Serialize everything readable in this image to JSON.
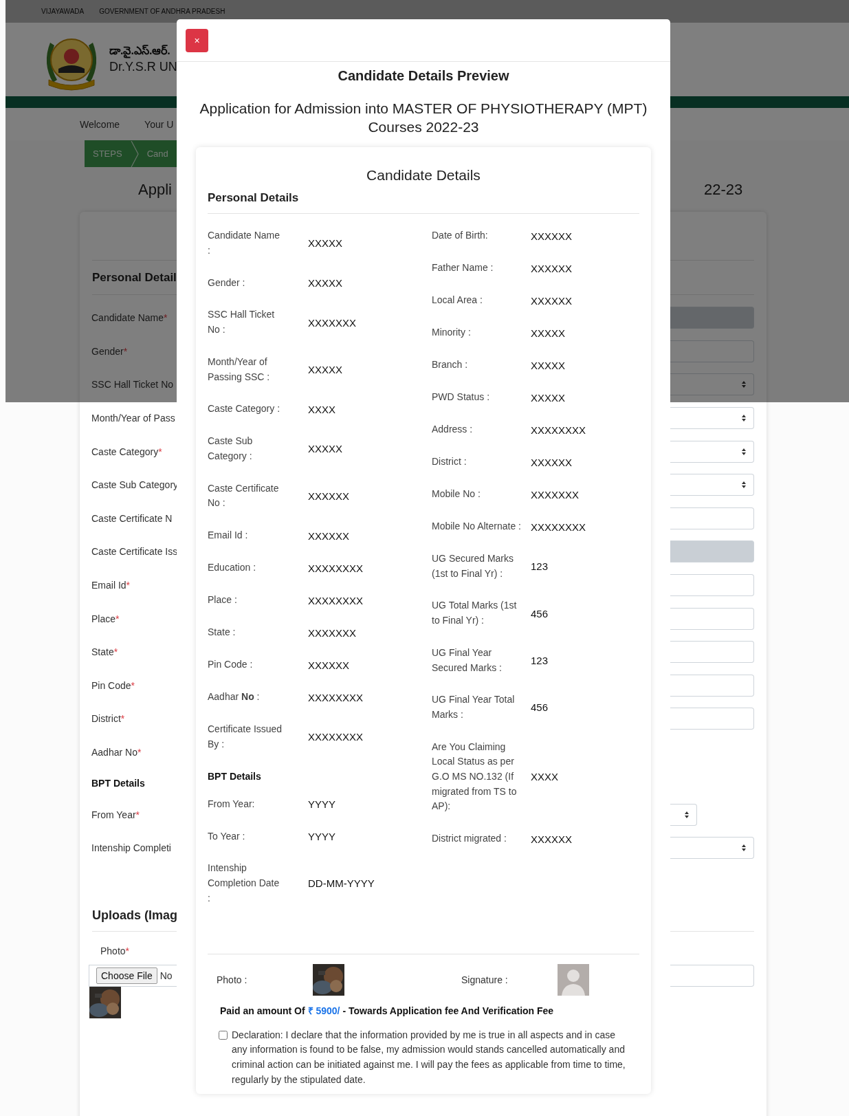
{
  "top_bar": [
    "VIJAYAWADA",
    "GOVERNMENT OF ANDHRA PRADESH"
  ],
  "header": {
    "title_telugu": "డా.వై.ఎస్.ఆర్.",
    "title": "Dr.Y.S.R UN"
  },
  "nav": [
    "Welcome",
    "Your U"
  ],
  "steps": [
    "STEPS",
    "Cand"
  ],
  "page_heading": {
    "left": "Appli",
    "right": "22-23"
  },
  "form": {
    "section": "Personal Detail",
    "rows": [
      {
        "kind": "field",
        "label": "Candidate Name",
        "mark": "*",
        "control": {
          "kind": "input",
          "disabled": true
        }
      },
      {
        "kind": "field",
        "label": "Gender",
        "mark": "*",
        "control": {
          "kind": "input",
          "disabled": false
        }
      },
      {
        "kind": "field",
        "label": "SSC Hall Ticket No",
        "control": {
          "kind": "select"
        }
      },
      {
        "kind": "field",
        "label": "Month/Year of Pass",
        "control": {
          "kind": "select"
        }
      },
      {
        "kind": "field",
        "label": "Caste Category",
        "mark": "*",
        "control": {
          "kind": "select"
        }
      },
      {
        "kind": "field",
        "label": "Caste Sub Category",
        "control": {
          "kind": "select"
        }
      },
      {
        "kind": "field",
        "label": "Caste Certificate N",
        "control": {
          "kind": "input",
          "disabled": false
        }
      },
      {
        "kind": "field",
        "label": "Caste Certificate Iss",
        "control": {
          "kind": "input",
          "disabled": true
        }
      },
      {
        "kind": "field",
        "label": "Email Id",
        "mark": "*",
        "control": {
          "kind": "input",
          "disabled": false
        }
      },
      {
        "kind": "field",
        "label": "Place",
        "mark": "*",
        "control": {
          "kind": "input",
          "disabled": false
        }
      },
      {
        "kind": "field",
        "label": "State",
        "mark": "*",
        "control": {
          "kind": "input",
          "disabled": false
        }
      },
      {
        "kind": "field",
        "label": "Pin Code",
        "mark": "*",
        "control": {
          "kind": "input",
          "disabled": false
        }
      },
      {
        "kind": "field",
        "label": "District",
        "mark": "*",
        "control": {
          "kind": "input",
          "disabled": false
        }
      },
      {
        "kind": "field",
        "label": "Aadhar No",
        "mark": "*"
      },
      {
        "kind": "heading",
        "label": "BPT Details"
      },
      {
        "kind": "field",
        "label": "From Year",
        "mark": "*",
        "control": {
          "kind": "short_select"
        }
      },
      {
        "kind": "field",
        "label": "Intenship Completi",
        "control": {
          "kind": "select"
        }
      }
    ],
    "uploads": {
      "title": "Uploads (Imag",
      "photo_label": "Photo",
      "photo_mark": "*",
      "choose_button": "Choose File",
      "file_status": "No"
    }
  },
  "modal": {
    "close": "×",
    "title": "Candidate Details Preview",
    "heading": "Application for Admission into MASTER OF PHYSIOTHERAPY (MPT) Courses 2022-23",
    "card_title": "Candidate Details",
    "section": "Personal Details",
    "left": [
      {
        "kind": "field",
        "label": "Candidate Name :",
        "value": "XXXXX"
      },
      {
        "kind": "field",
        "label": "Gender :",
        "value": "XXXXX"
      },
      {
        "kind": "field",
        "label": "SSC Hall Ticket No :",
        "value": "XXXXXXX"
      },
      {
        "kind": "field",
        "label": "Month/Year of Passing SSC :",
        "value": "XXXXX"
      },
      {
        "kind": "field",
        "label": "Caste Category :",
        "value": "XXXX"
      },
      {
        "kind": "field",
        "label": "Caste Sub Category :",
        "value": "XXXXX"
      },
      {
        "kind": "field",
        "label": "Caste Certificate No :",
        "value": "XXXXXX"
      },
      {
        "kind": "field",
        "label": "Email Id :",
        "value": "XXXXXX"
      },
      {
        "kind": "field",
        "label": "Education :",
        "value": "XXXXXXXX"
      },
      {
        "kind": "field",
        "label": "Place :",
        "value": "XXXXXXXX"
      },
      {
        "kind": "field",
        "label": "State :",
        "value": "XXXXXXX"
      },
      {
        "kind": "field",
        "label": "Pin Code :",
        "value": "XXXXXX"
      },
      {
        "kind": "field",
        "label": "Aadhar **No** :",
        "value": "XXXXXXXX"
      },
      {
        "kind": "field",
        "label": "Certificate Issued By :",
        "value": "XXXXXXXX"
      },
      {
        "kind": "heading",
        "label": "BPT Details"
      },
      {
        "kind": "field",
        "label": "From Year:",
        "value": "YYYY"
      },
      {
        "kind": "field",
        "label": "To Year :",
        "value": "YYYY"
      },
      {
        "kind": "field",
        "label": "Intenship Completion Date :",
        "value": "DD-MM-YYYY"
      }
    ],
    "right": [
      {
        "kind": "field",
        "label": "Date of Birth:",
        "value": "XXXXXX"
      },
      {
        "kind": "field",
        "label": "Father Name :",
        "value": "XXXXXX"
      },
      {
        "kind": "field",
        "label": "Local Area :",
        "value": "XXXXXX"
      },
      {
        "kind": "field",
        "label": "Minority :",
        "value": "XXXXX"
      },
      {
        "kind": "field",
        "label": "Branch :",
        "value": "XXXXX"
      },
      {
        "kind": "field",
        "label": "PWD Status :",
        "value": "XXXXX"
      },
      {
        "kind": "field",
        "label": "Address :",
        "value": "XXXXXXXX"
      },
      {
        "kind": "field",
        "label": "District :",
        "value": "XXXXXX"
      },
      {
        "kind": "field",
        "label": "Mobile No :",
        "value": "XXXXXXX"
      },
      {
        "kind": "field",
        "label": "Mobile No Alternate :",
        "value": "XXXXXXXX"
      },
      {
        "kind": "field",
        "label": "UG Secured Marks (1st to Final Yr) :",
        "value": "123"
      },
      {
        "kind": "field",
        "label": "UG Total Marks (1st to Final Yr) :",
        "value": "456"
      },
      {
        "kind": "field",
        "label": "UG Final Year Secured Marks :",
        "value": "123"
      },
      {
        "kind": "field",
        "label": "UG Final Year Total Marks :",
        "value": "456"
      },
      {
        "kind": "field",
        "label": "Are You Claiming Local Status as per G.O MS NO.132 (If migrated from TS to AP):",
        "value": "XXXX"
      },
      {
        "kind": "field",
        "label": "District migrated :",
        "value": "XXXXXX"
      }
    ],
    "photo_label": "Photo :",
    "signature_label": "Signature :",
    "payment": {
      "before": "Paid an amount Of",
      "amount": "₹ 5900/",
      "after": "- Towards Application fee And Verification Fee"
    },
    "declaration": {
      "checked": false,
      "text": "Declaration: I declare that the information provided by me is true in all aspects and in case any information is found to be false, my admission would stands cancelled automatically and criminal action can be initiated against me. I will pay the fees as applicable from time to time, regularly by the stipulated date."
    }
  }
}
